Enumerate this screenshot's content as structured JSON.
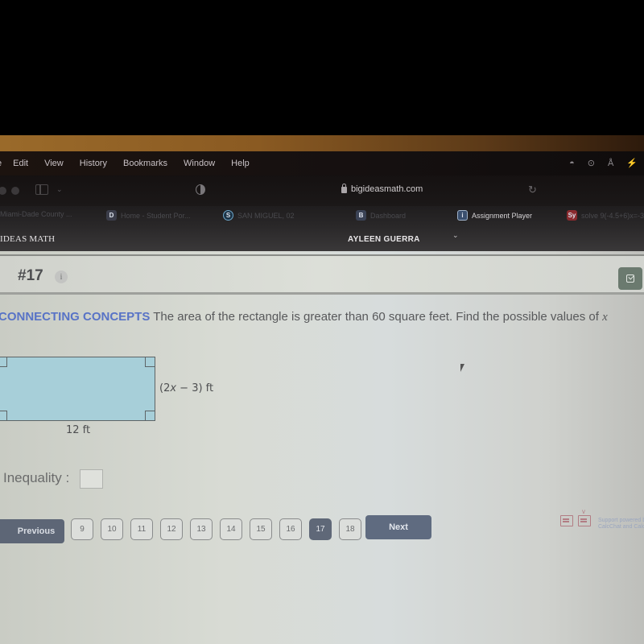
{
  "menubar": {
    "items": [
      "e",
      "Edit",
      "View",
      "History",
      "Bookmarks",
      "Window",
      "Help"
    ],
    "status_icons": [
      "wifi-icon",
      "play-icon",
      "keyboard-input-icon",
      "battery-icon"
    ],
    "status_labels": [
      "◓",
      "⊙",
      "Å",
      "⚡"
    ]
  },
  "browser": {
    "url": "bigideasmath.com",
    "tabs": [
      {
        "label": "Miami-Dade County ...",
        "favicon": "",
        "favicon_color": "#2a2829",
        "active": false
      },
      {
        "label": "Home - Student Por...",
        "favicon": "D",
        "favicon_color": "#3b3d4a",
        "active": false
      },
      {
        "label": "SAN MIGUEL, 02",
        "favicon": "S",
        "favicon_color": "#1c3447",
        "active": false
      },
      {
        "label": "Dashboard",
        "favicon": "B",
        "favicon_color": "#3a4255",
        "active": false
      },
      {
        "label": "Assignment Player",
        "favicon": "i",
        "favicon_color": "#3a4f6e",
        "active": true
      },
      {
        "label": "solve 9(-4.5+6)x=-3",
        "favicon": "Sy",
        "favicon_color": "#8a2a2e",
        "active": false
      }
    ]
  },
  "app": {
    "brand": "IDEAS MATH",
    "user_name": "AYLEEN GUERRA",
    "user_menu_icon": "⌄"
  },
  "question": {
    "number": "#17",
    "info_icon": "i",
    "lead": "CONNECTING CONCEPTS",
    "text": " The area of the rectangle is greater than 60 square feet. Find the possible values of ",
    "variable": "x",
    "diagram": {
      "height_prefix": "(2",
      "height_var": "x",
      "height_suffix": " − 3) ft",
      "width_label": "12 ft",
      "area_threshold_sqft": 60
    },
    "answer_label": "Inequality :",
    "answer_value": ""
  },
  "navigation": {
    "previous_label": "Previous",
    "next_label": "Next",
    "pages": [
      "9",
      "10",
      "11",
      "12",
      "13",
      "14",
      "15",
      "16",
      "17",
      "18"
    ],
    "current_page": "17"
  },
  "support": {
    "line1": "Support powered by",
    "line2": "CalcChat and CalcView"
  }
}
